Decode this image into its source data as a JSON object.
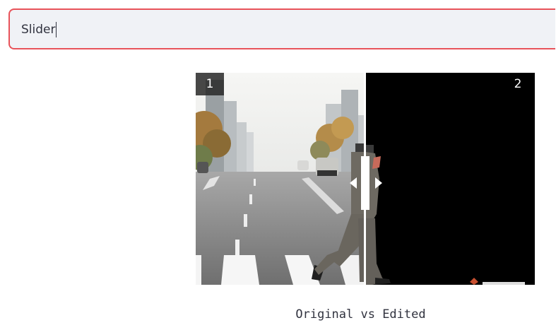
{
  "search": {
    "value": "Slider"
  },
  "comparison": {
    "left_label": "1",
    "right_label": "2",
    "caption": "Original vs Edited"
  },
  "colors": {
    "focus_border": "#e8535a",
    "input_bg": "#f0f2f6"
  },
  "icons": {
    "handle_left": "triangle-left-icon",
    "handle_right": "triangle-right-icon"
  }
}
